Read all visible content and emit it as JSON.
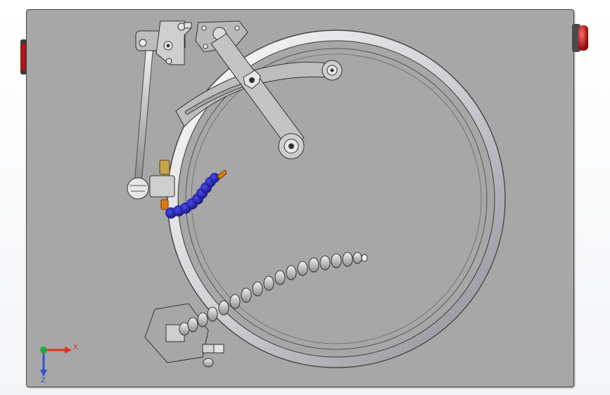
{
  "viewport": {
    "background": "#a7a7a7"
  },
  "triad": {
    "x_label": "X",
    "z_label": "Z",
    "x_color": "#e0301e",
    "y_color": "#1faa3a",
    "z_color": "#2f55d4"
  },
  "colors": {
    "hose_blue": "#1a1aa8",
    "nozzle_orange": "#e07a10",
    "fitting_brass": "#c8a24a",
    "button_red": "#d21818"
  }
}
